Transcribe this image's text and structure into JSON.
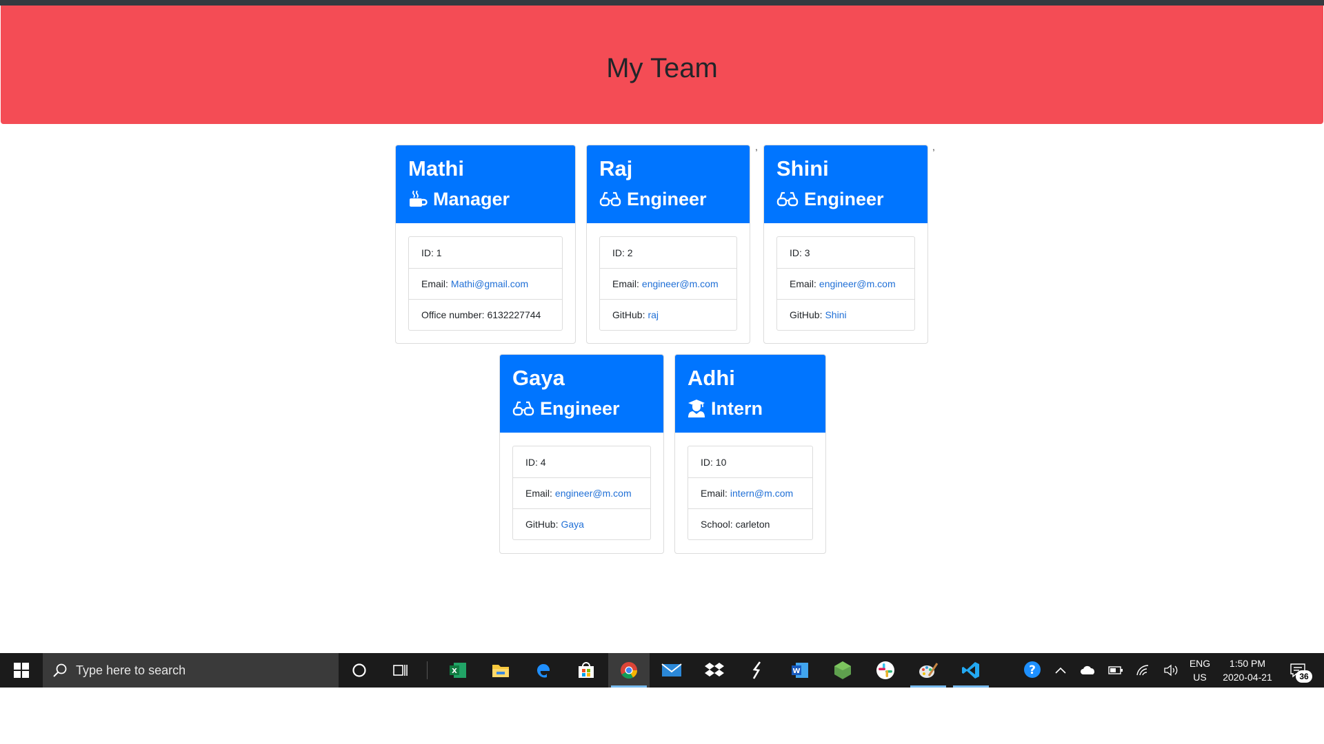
{
  "header": {
    "title": "My Team"
  },
  "cards": [
    {
      "name": "Mathi",
      "role": "Manager",
      "role_icon": "coffee-mug-icon",
      "items": [
        {
          "label": "ID: 1",
          "link": ""
        },
        {
          "label": "Email:",
          "link": "Mathi@gmail.com"
        },
        {
          "label": "Office number: 6132227744",
          "link": ""
        }
      ]
    },
    {
      "name": "Raj",
      "role": "Engineer",
      "role_icon": "glasses-icon",
      "items": [
        {
          "label": "ID: 2",
          "link": ""
        },
        {
          "label": "Email:",
          "link": "engineer@m.com"
        },
        {
          "label": "GitHub:",
          "link": "raj"
        }
      ]
    },
    {
      "name": "Shini",
      "role": "Engineer",
      "role_icon": "glasses-icon",
      "items": [
        {
          "label": "ID: 3",
          "link": ""
        },
        {
          "label": "Email:",
          "link": "engineer@m.com"
        },
        {
          "label": "GitHub:",
          "link": "Shini"
        }
      ]
    },
    {
      "name": "Gaya",
      "role": "Engineer",
      "role_icon": "glasses-icon",
      "items": [
        {
          "label": "ID: 4",
          "link": ""
        },
        {
          "label": "Email:",
          "link": "engineer@m.com"
        },
        {
          "label": "GitHub:",
          "link": "Gaya"
        }
      ]
    },
    {
      "name": "Adhi",
      "role": "Intern",
      "role_icon": "graduate-icon",
      "items": [
        {
          "label": "ID: 10",
          "link": ""
        },
        {
          "label": "Email:",
          "link": "intern@m.com"
        },
        {
          "label": "School: carleton",
          "link": ""
        }
      ]
    }
  ],
  "stray_commas": [
    ",",
    ","
  ],
  "taskbar": {
    "search_placeholder": "Type here to search",
    "apps": [
      "cortana-icon",
      "task-view-icon",
      "excel-icon",
      "file-explorer-icon",
      "edge-icon",
      "store-icon",
      "chrome-icon",
      "mail-icon",
      "dropbox-icon",
      "sublime-icon",
      "word-icon",
      "nodejs-icon",
      "slack-icon",
      "paint-icon",
      "vscode-icon"
    ],
    "language_line1": "ENG",
    "language_line2": "US",
    "time": "1:50 PM",
    "date": "2020-04-21",
    "notification_count": "36",
    "colors": {
      "taskbar": "#1b1b1b",
      "search": "#3a3a3a",
      "accent": "#76b9ed"
    }
  },
  "colors": {
    "header": "#f44c55",
    "card_header": "#0075ff",
    "link": "#1f6fd6"
  }
}
